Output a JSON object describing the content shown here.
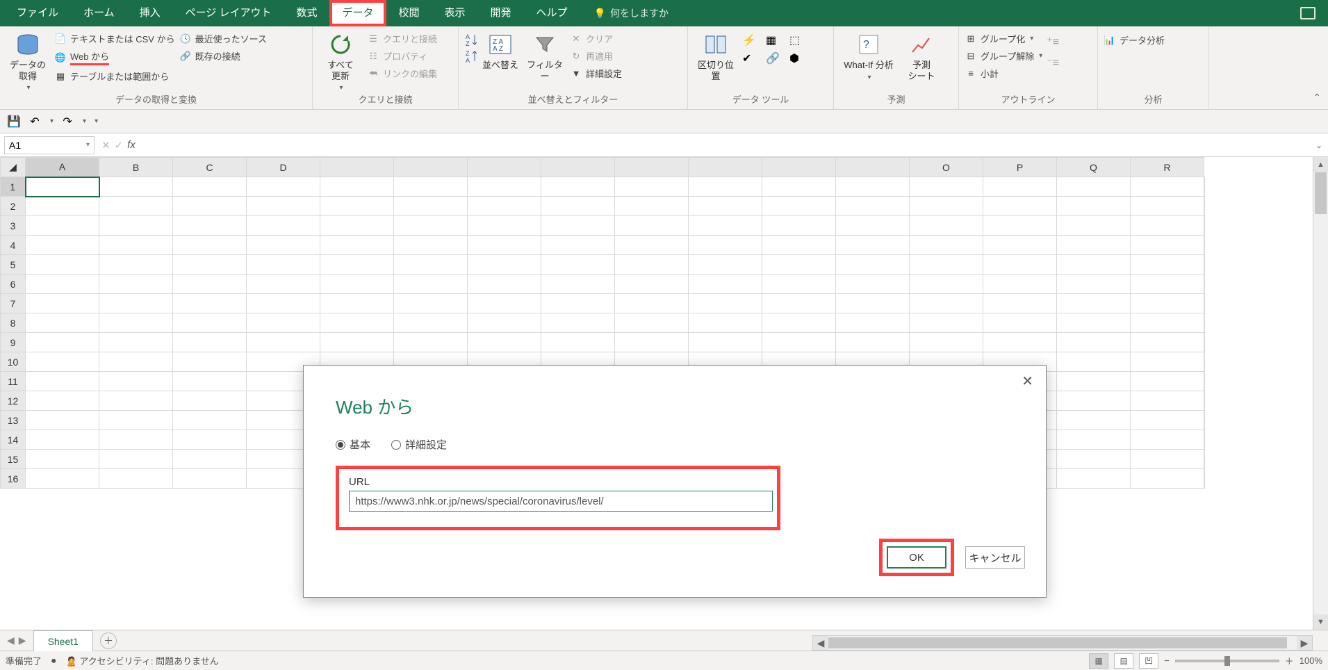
{
  "tabs": [
    "ファイル",
    "ホーム",
    "挿入",
    "ページ レイアウト",
    "数式",
    "データ",
    "校閲",
    "表示",
    "開発",
    "ヘルプ"
  ],
  "activeTab": "データ",
  "tellme": "何をしますか",
  "ribbon": {
    "g1": {
      "big": "データの\n取得",
      "items": [
        "テキストまたは CSV から",
        "Web から",
        "テーブルまたは範囲から",
        "最近使ったソース",
        "既存の接続"
      ],
      "label": "データの取得と変換"
    },
    "g2": {
      "big": "すべて\n更新",
      "items": [
        "クエリと接続",
        "プロパティ",
        "リンクの編集"
      ],
      "label": "クエリと接続"
    },
    "g3": {
      "big1": "並べ替え",
      "big2": "フィルター",
      "items": [
        "クリア",
        "再適用",
        "詳細設定"
      ],
      "label": "並べ替えとフィルター"
    },
    "g4": {
      "big": "区切り位置",
      "label": "データ ツール"
    },
    "g5": {
      "big1": "What-If 分析",
      "big2": "予測\nシート",
      "label": "予測"
    },
    "g6": {
      "items": [
        "グループ化",
        "グループ解除",
        "小計"
      ],
      "label": "アウトライン"
    },
    "g7": {
      "item": "データ分析",
      "label": "分析"
    }
  },
  "namebox": "A1",
  "columns": [
    "A",
    "B",
    "C",
    "D",
    "",
    "",
    "",
    "",
    "",
    "",
    "",
    "",
    "",
    "O",
    "P",
    "Q",
    "R"
  ],
  "rows": [
    1,
    2,
    3,
    4,
    5,
    6,
    7,
    8,
    9,
    10,
    11,
    12,
    13,
    14,
    15,
    16
  ],
  "dialog": {
    "title": "Web から",
    "radio1": "基本",
    "radio2": "詳細設定",
    "urlLabel": "URL",
    "urlValue": "https://www3.nhk.or.jp/news/special/coronavirus/level/",
    "ok": "OK",
    "cancel": "キャンセル"
  },
  "sheet": "Sheet1",
  "status": {
    "ready": "準備完了",
    "acc": "アクセシビリティ: 問題ありません",
    "zoom": "100%"
  }
}
